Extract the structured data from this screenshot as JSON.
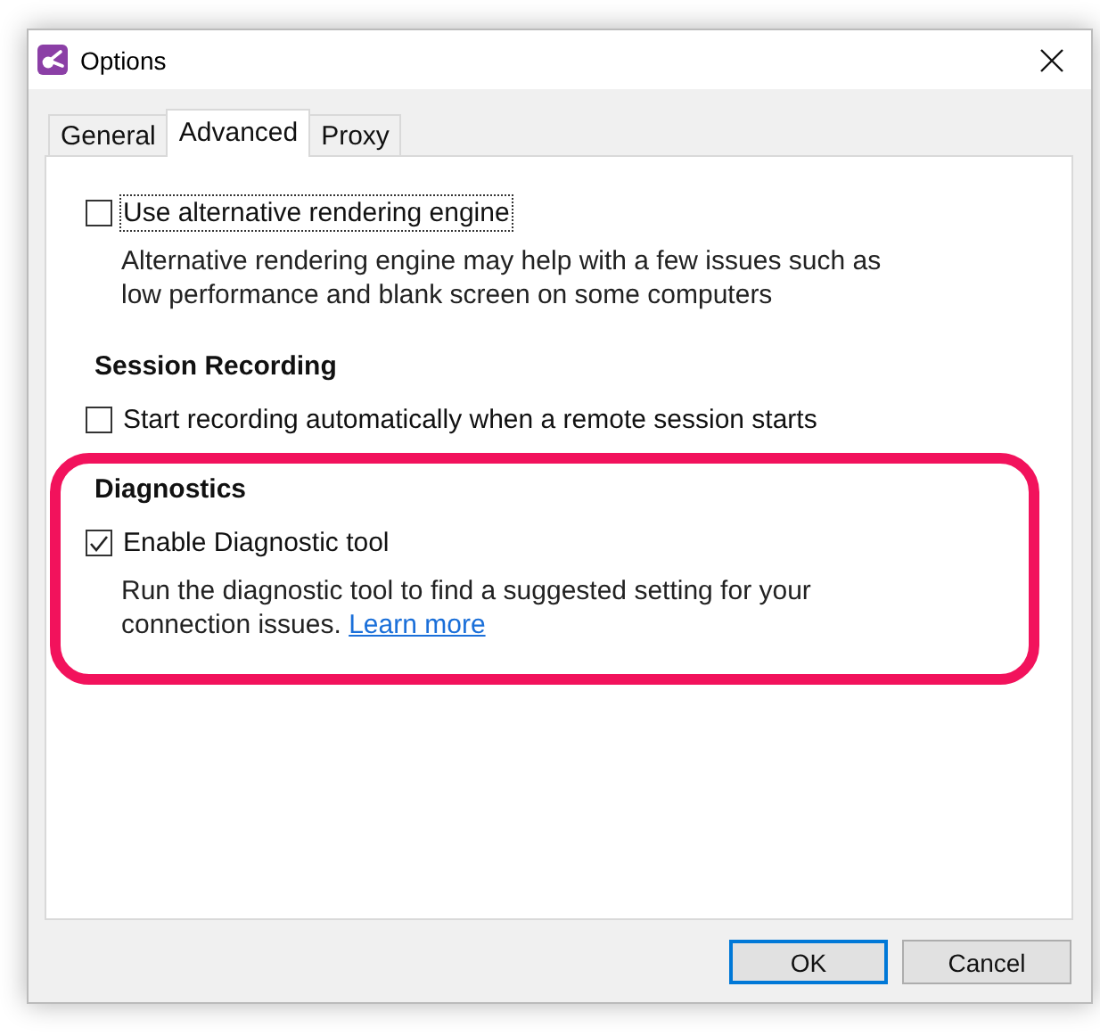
{
  "window": {
    "title": "Options"
  },
  "tabs": [
    {
      "label": "General",
      "selected": false
    },
    {
      "label": "Advanced",
      "selected": true
    },
    {
      "label": "Proxy",
      "selected": false
    }
  ],
  "sections": [
    {
      "highlighted": false,
      "options": [
        {
          "label": "Use alternative rendering engine",
          "checked": false,
          "focused": true,
          "description_lines": [
            "Alternative rendering engine may help with a few issues such as",
            "low performance and blank screen on some computers"
          ]
        }
      ]
    },
    {
      "heading": "Session Recording",
      "highlighted": false,
      "options": [
        {
          "label": "Start recording automatically when a remote session starts",
          "checked": false,
          "focused": false
        }
      ]
    },
    {
      "heading": "Diagnostics",
      "highlighted": true,
      "options": [
        {
          "label": "Enable Diagnostic tool",
          "checked": true,
          "focused": false,
          "description_lines": [
            "Run the diagnostic tool to find a suggested setting for your",
            "connection issues."
          ],
          "link": "Learn more"
        }
      ]
    }
  ],
  "buttons": [
    {
      "label": "OK",
      "default": true
    },
    {
      "label": "Cancel",
      "default": false
    }
  ]
}
